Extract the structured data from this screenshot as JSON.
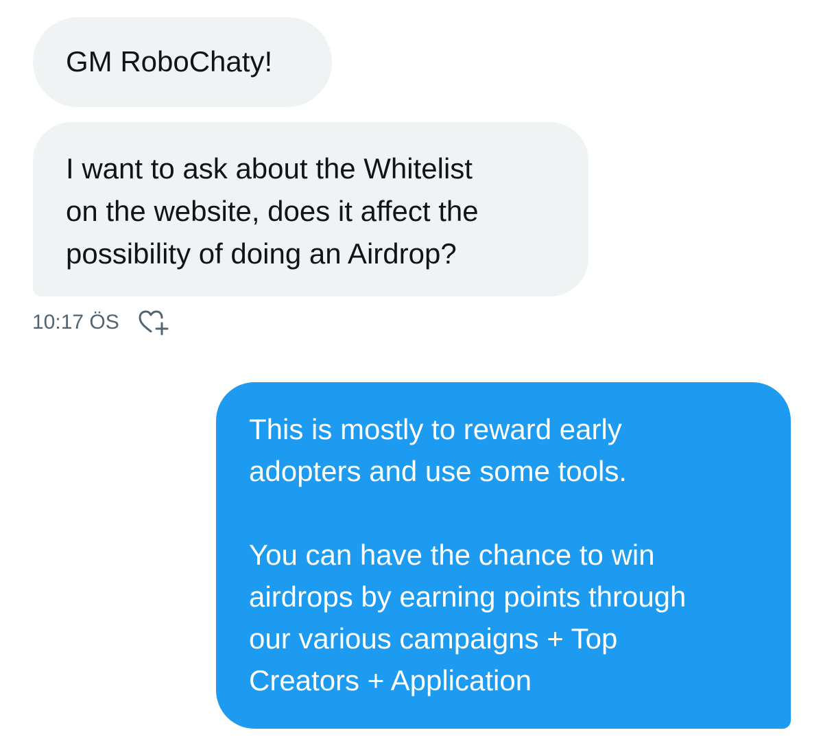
{
  "conversation": {
    "messages": [
      {
        "sender": "other",
        "text": "GM RoboChaty!"
      },
      {
        "sender": "other",
        "text": "I want to ask about the Whitelist\non the website, does it affect the\npossibility of doing an Airdrop?"
      },
      {
        "sender": "self",
        "text": "This is mostly to reward early\nadopters and use some tools.\n\nYou can have the chance to win\nairdrops by earning points through\nour various campaigns + Top\nCreators + Application"
      }
    ],
    "timestamp": "10:17 ÖS",
    "react_icon": "heart-plus-icon"
  },
  "colors": {
    "incoming_bubble": "#eff3f4",
    "outgoing_bubble": "#1d9bf0",
    "timestamp_text": "#536471"
  }
}
